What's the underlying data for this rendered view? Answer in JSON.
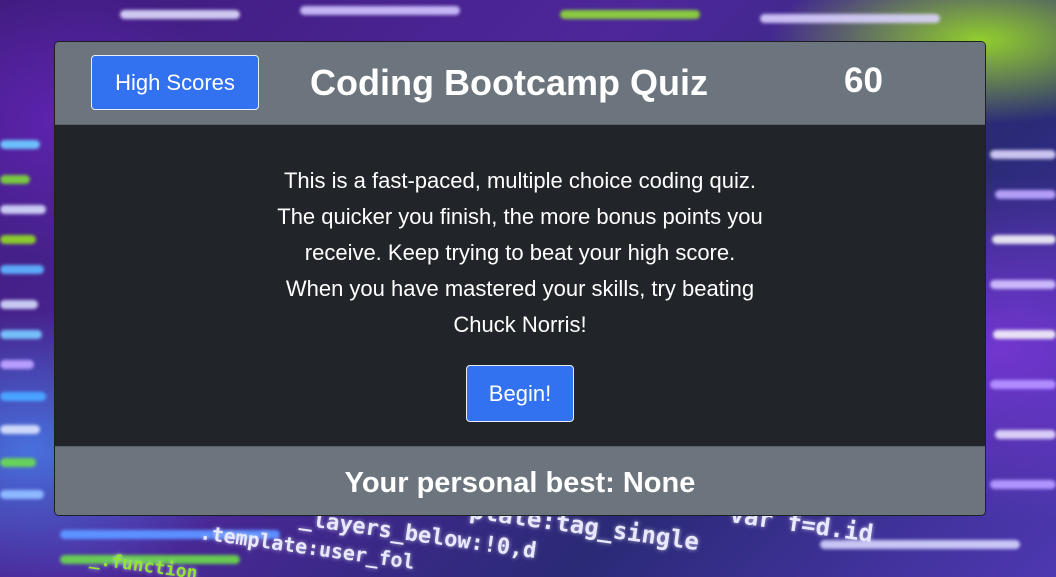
{
  "header": {
    "high_scores_label": "High Scores",
    "title": "Coding Bootcamp Quiz",
    "timer": "60"
  },
  "body": {
    "intro_lines": [
      "This is a fast-paced, multiple choice coding quiz.",
      "The quicker you finish, the more bonus points you",
      "receive. Keep trying to beat your high score.",
      "When you have mastered your skills, try beating",
      "Chuck Norris!"
    ],
    "begin_label": "Begin!"
  },
  "footer": {
    "personal_best": "Your personal best: None"
  },
  "background": {
    "code_fragments": [
      "_layers_below:!0,d",
      ".template:user_fol",
      "_.function",
      "plate:tag_single",
      "var f=d.id"
    ]
  },
  "colors": {
    "header_bg": "#6c757d",
    "body_bg": "#212529",
    "button_bg": "#3272f0"
  }
}
